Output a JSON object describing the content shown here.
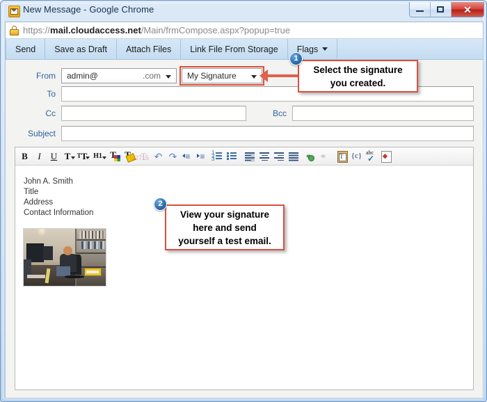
{
  "window": {
    "title": "New Message - Google Chrome",
    "icon": "mail-icon",
    "buttons": {
      "minimize": "minimize-icon",
      "maximize": "maximize-icon",
      "close": "✕"
    }
  },
  "address_bar": {
    "lock_icon": "ssl-warning-lock-icon",
    "scheme": "https://",
    "host": "mail.cloudaccess.net",
    "path": "/Main/frmCompose.aspx?popup=true"
  },
  "app_toolbar": {
    "items": [
      {
        "label": "Send",
        "has_caret": false
      },
      {
        "label": "Save as Draft",
        "has_caret": false
      },
      {
        "label": "Attach Files",
        "has_caret": false
      },
      {
        "label": "Link File From Storage",
        "has_caret": false
      },
      {
        "label": "Flags",
        "has_caret": true
      }
    ]
  },
  "compose_form": {
    "from_label": "From",
    "from_value": "admin@",
    "from_suffix": ".com",
    "signature_label": "signature-select",
    "signature_value": "My Signature",
    "to_label": "To",
    "to_value": "",
    "cc_label": "Cc",
    "cc_value": "",
    "bcc_label": "Bcc",
    "bcc_value": "",
    "subject_label": "Subject",
    "subject_value": ""
  },
  "editor": {
    "toolbar": [
      {
        "name": "bold-icon",
        "glyph": "B",
        "style": "bold-serif",
        "caret": false,
        "dim": false
      },
      {
        "name": "italic-icon",
        "glyph": "I",
        "style": "italic-serif",
        "caret": false,
        "dim": false
      },
      {
        "name": "underline-icon",
        "glyph": "U",
        "style": "underline-serif",
        "caret": false,
        "dim": false
      },
      {
        "name": "font-name-icon",
        "glyph": "T",
        "style": "serif",
        "caret": true,
        "dim": false
      },
      {
        "name": "font-size-icon",
        "glyph": "ᴛT",
        "style": "serif",
        "caret": true,
        "dim": false
      },
      {
        "name": "heading-icon",
        "glyph": "H1",
        "style": "serif-small",
        "caret": true,
        "dim": false
      },
      {
        "name": "font-color-icon",
        "glyph": "T",
        "style": "color-swatch",
        "caret": false,
        "dim": false
      },
      {
        "name": "highlight-color-icon",
        "glyph": "T",
        "style": "highlight",
        "caret": false,
        "dim": false
      },
      {
        "name": "remove-format-icon",
        "glyph": "T",
        "style": "serif",
        "caret": false,
        "dim": true
      },
      {
        "name": "undo-icon",
        "glyph": "↶",
        "style": "arrow",
        "caret": false,
        "dim": false
      },
      {
        "name": "redo-icon",
        "glyph": "↷",
        "style": "arrow",
        "caret": false,
        "dim": false
      },
      {
        "name": "decrease-indent-icon",
        "glyph": "≡",
        "style": "indent",
        "caret": false,
        "dim": false
      },
      {
        "name": "increase-indent-icon",
        "glyph": "≡",
        "style": "indent",
        "caret": false,
        "dim": false
      },
      {
        "name": "numbered-list-icon",
        "glyph": "≡",
        "style": "list-num",
        "caret": false,
        "dim": false
      },
      {
        "name": "bulleted-list-icon",
        "glyph": "≡",
        "style": "list-bul",
        "caret": false,
        "dim": false
      },
      {
        "name": "align-left-icon",
        "glyph": "≡",
        "style": "align-l",
        "caret": false,
        "dim": false
      },
      {
        "name": "align-center-icon",
        "glyph": "≡",
        "style": "align-c",
        "caret": false,
        "dim": false
      },
      {
        "name": "align-right-icon",
        "glyph": "≡",
        "style": "align-r",
        "caret": false,
        "dim": false
      },
      {
        "name": "align-justify-icon",
        "glyph": "≡",
        "style": "align-j",
        "caret": false,
        "dim": false
      },
      {
        "name": "insert-link-icon",
        "glyph": "⚭",
        "style": "link",
        "caret": false,
        "dim": false
      },
      {
        "name": "unlink-icon",
        "glyph": "⚭",
        "style": "link",
        "caret": false,
        "dim": true
      },
      {
        "name": "paste-as-text-icon",
        "glyph": "T",
        "style": "clipboard",
        "caret": false,
        "dim": false
      },
      {
        "name": "insert-template-icon",
        "glyph": "{c}",
        "style": "braces",
        "caret": false,
        "dim": false
      },
      {
        "name": "spellcheck-icon",
        "glyph": "abc",
        "style": "spell",
        "caret": false,
        "dim": false
      },
      {
        "name": "source-code-icon",
        "glyph": "◇",
        "style": "source",
        "caret": false,
        "dim": false
      }
    ],
    "signature_lines": [
      "John A. Smith",
      "Title",
      "Address",
      "Contact Information"
    ],
    "image_alt": "office-desk-photo"
  },
  "annotations": [
    {
      "number": "1",
      "text_line_1": "Select the signature",
      "text_line_2": "you created."
    },
    {
      "number": "2",
      "text_line_1": "View your signature",
      "text_line_2": "here and send",
      "text_line_3": "yourself a test email."
    }
  ],
  "colors": {
    "annotation_border": "#d9503f",
    "annotation_arrow": "#e0614c",
    "badge": "#2b6cab",
    "label_blue": "#2c5f9e",
    "toolbar_blue": "#c4dcf1"
  }
}
